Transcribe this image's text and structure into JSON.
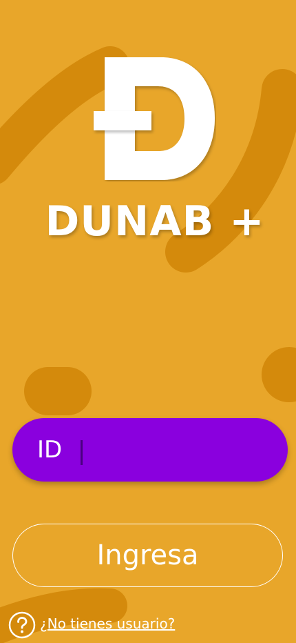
{
  "app": {
    "brand_title": "DUNAB +"
  },
  "login": {
    "id_label": "ID",
    "id_value": "",
    "submit_label": "Ingresa"
  },
  "footer": {
    "signup_link": "¿No tienes usuario?"
  },
  "icons": {
    "logo": "dunab-logo-icon",
    "help": "question-circle-icon"
  },
  "colors": {
    "background": "#E8A62A",
    "decoration": "#D48A0C",
    "primary": "#8A00DE",
    "text": "#FFFFFF"
  }
}
